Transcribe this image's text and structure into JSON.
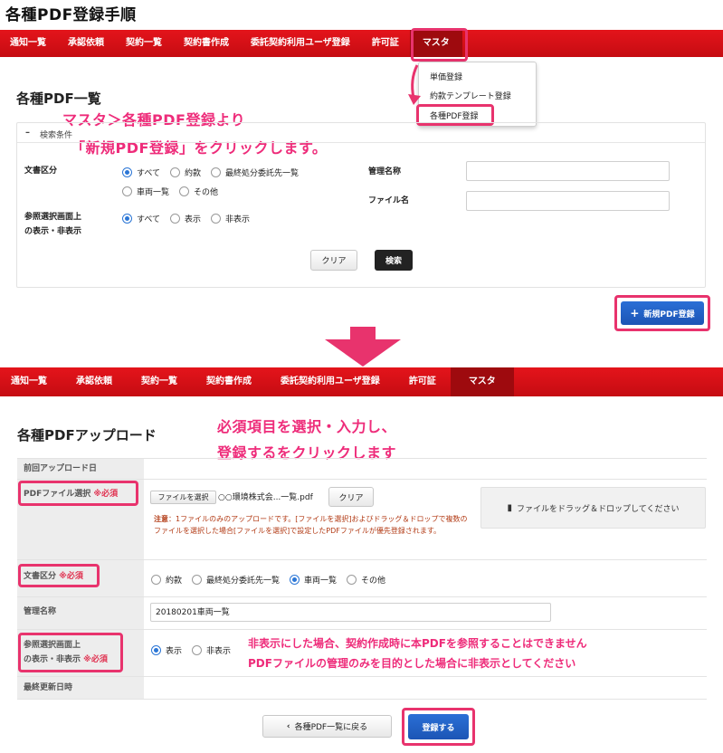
{
  "doc_title": "各種PDF登録手順",
  "nav_items": [
    "通知一覧",
    "承認依頼",
    "契約一覧",
    "契約書作成",
    "委託契約利用ユーザ登録",
    "許可証",
    "マスタ"
  ],
  "dropdown_items": [
    "単価登録",
    "約款テンプレート登録",
    "各種PDF登録"
  ],
  "list_page": {
    "title": "各種PDF一覧",
    "search_section": "検索条件",
    "doc_type_label": "文書区分",
    "doc_type_options_row1": [
      "すべて",
      "約款",
      "最終処分委託先一覧"
    ],
    "doc_type_options_row2": [
      "車両一覧",
      "その他"
    ],
    "ref_label_line1": "参照選択画面上",
    "ref_label_line2": "の表示・非表示",
    "ref_options": [
      "すべて",
      "表示",
      "非表示"
    ],
    "mgmt_name_label": "管理名称",
    "file_name_label": "ファイル名",
    "clear_button": "クリア",
    "search_button": "検索",
    "new_button": "新規PDF登録"
  },
  "annotations": {
    "step1_line1": "マスタ＞各種PDF登録より",
    "step1_line2": "「新規PDF登録」をクリックします。",
    "step2_line1": "必須項目を選択・入力し、",
    "step2_line2": "登録するをクリックします",
    "step3_line1": "非表示にした場合、契約作成時に本PDFを参照することはできません",
    "step3_line2": "PDFファイルの管理のみを目的とした場合に非表示としてください"
  },
  "upload_page": {
    "title": "各種PDFアップロード",
    "last_upload_label": "前回アップロード日",
    "pdf_select_label": "PDFファイル選択",
    "required": "※必須",
    "file_select_button": "ファイルを選択",
    "file_name": "○○環境株式会...一覧.pdf",
    "clear_button": "クリア",
    "note_prefix": "注意",
    "note_text": "：1ファイルのみのアップロードです。[ファイルを選択]およびドラッグ＆ドロップで複数のファイルを選択した場合[ファイルを選択]で設定したPDFファイルが優先登録されます。",
    "drop_zone": "ファイルをドラッグ＆ドロップしてください",
    "doc_type_label": "文書区分",
    "doc_type_options": [
      "約款",
      "最終処分委託先一覧",
      "車両一覧",
      "その他"
    ],
    "mgmt_name_label": "管理名称",
    "mgmt_name_value": "20180201車両一覧",
    "ref_label_line1": "参照選択画面上",
    "ref_label_line2": "の表示・非表示",
    "ref_options": [
      "表示",
      "非表示"
    ],
    "last_updated_label": "最終更新日時",
    "back_button": "各種PDF一覧に戻る",
    "register_button": "登録する"
  },
  "colors": {
    "nav_red": "#d91016",
    "highlight_pink": "#e8336d",
    "button_blue": "#2a6fd6",
    "annotation_pink": "#ee2c7a"
  }
}
